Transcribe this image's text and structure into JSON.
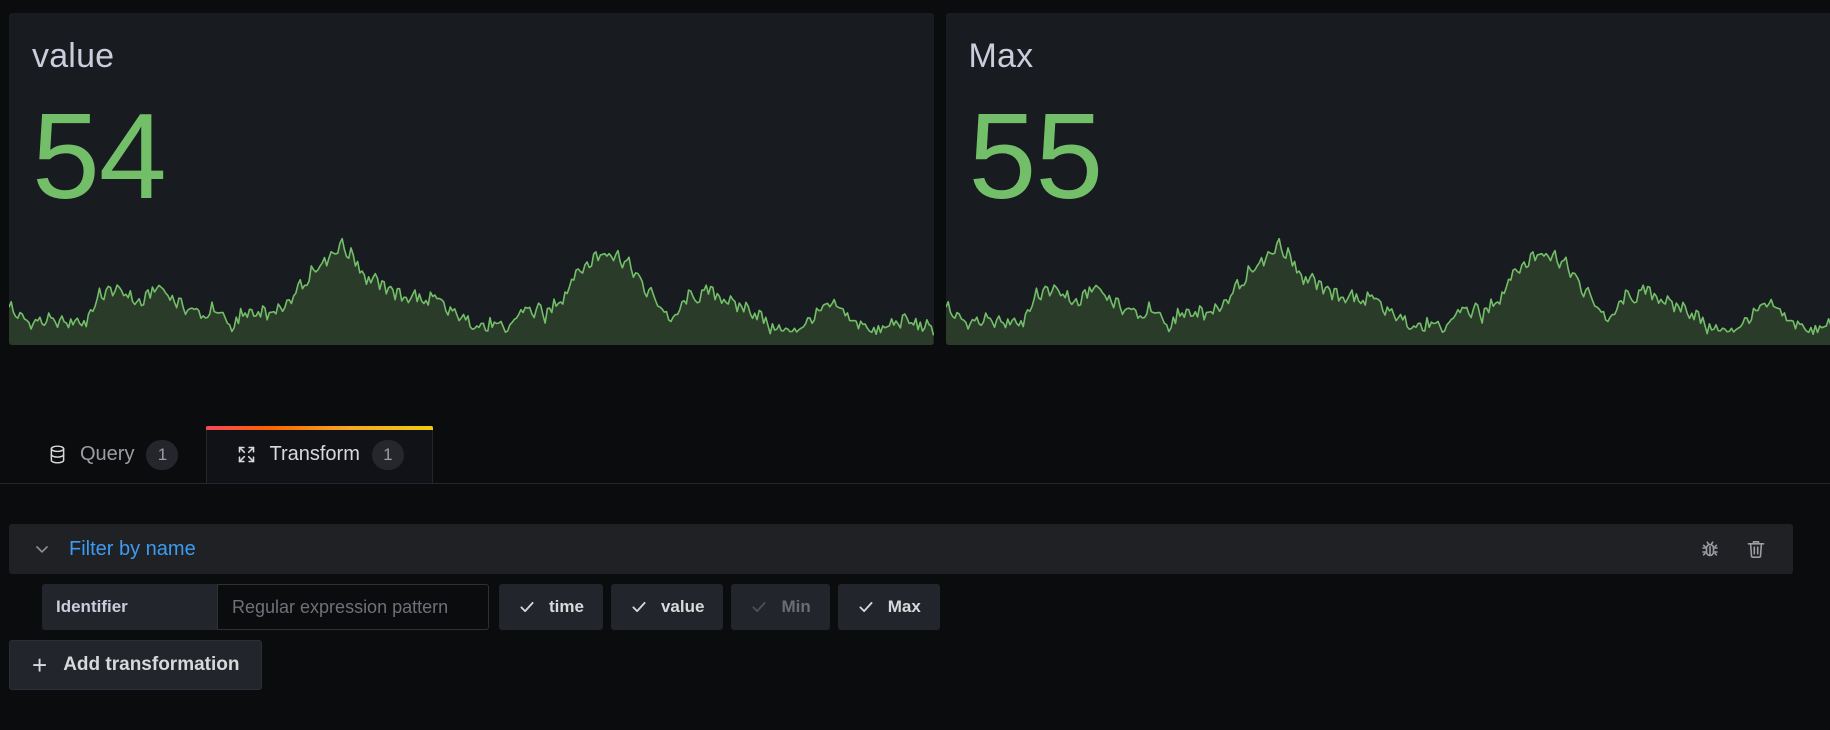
{
  "panels": [
    {
      "title": "value",
      "value": "54",
      "color": "#73bf69",
      "fill": "#2a3b2a"
    },
    {
      "title": "Max",
      "value": "55",
      "color": "#73bf69",
      "fill": "#2a3b2a"
    }
  ],
  "tabs": [
    {
      "label": "Query",
      "badge": "1",
      "icon": "database-icon",
      "active": false
    },
    {
      "label": "Transform",
      "badge": "1",
      "icon": "transform-icon",
      "active": true
    }
  ],
  "transformation": {
    "name": "Filter by name",
    "expanded": true,
    "identifier_label": "Identifier",
    "regex_value": "",
    "regex_placeholder": "Regular expression pattern",
    "fields": [
      {
        "label": "time",
        "checked": true
      },
      {
        "label": "value",
        "checked": true
      },
      {
        "label": "Min",
        "checked": false
      },
      {
        "label": "Max",
        "checked": true
      }
    ],
    "debug_title": "Debug",
    "remove_title": "Remove"
  },
  "add_transformation_label": "Add transformation",
  "chart_data": {
    "type": "area",
    "title": "",
    "xlabel": "",
    "ylabel": "",
    "grid": false,
    "legend": "none",
    "series": [
      {
        "name": "value",
        "color": "#73bf69",
        "fill": "#2a3b2a",
        "values": [
          44,
          41,
          39,
          40,
          38,
          36,
          37,
          35,
          36,
          38,
          36,
          35,
          37,
          36,
          34,
          36,
          35,
          37,
          35,
          34,
          36,
          38,
          36,
          35,
          37,
          39,
          41,
          44,
          47,
          45,
          48,
          50,
          48,
          49,
          47,
          48,
          46,
          48,
          46,
          44,
          45,
          43,
          44,
          46,
          48,
          50,
          48,
          51,
          49,
          47,
          48,
          46,
          44,
          45,
          43,
          41,
          42,
          40,
          41,
          39,
          40,
          38,
          39,
          41,
          39,
          38,
          40,
          38,
          36,
          34,
          35,
          37,
          39,
          38,
          40,
          39,
          37,
          39,
          38,
          40,
          39,
          38,
          40,
          42,
          41,
          40,
          42,
          44,
          46,
          49,
          52,
          50,
          53,
          55,
          58,
          56,
          59,
          62,
          60,
          63,
          65,
          63,
          66,
          68,
          66,
          64,
          65,
          63,
          60,
          58,
          56,
          54,
          52,
          54,
          52,
          50,
          51,
          49,
          51,
          49,
          47,
          48,
          46,
          47,
          45,
          46,
          48,
          46,
          44,
          43,
          45,
          47,
          45,
          43,
          44,
          42,
          40,
          41,
          39,
          38,
          40,
          38,
          36,
          37,
          35,
          36,
          34,
          35,
          33,
          34,
          36,
          35,
          33,
          34,
          32,
          33,
          35,
          37,
          39,
          41,
          40,
          42,
          41,
          39,
          41,
          40,
          38,
          39,
          41,
          43,
          45,
          44,
          46,
          48,
          51,
          54,
          57,
          55,
          58,
          61,
          59,
          62,
          64,
          62,
          65,
          63,
          66,
          64,
          62,
          63,
          61,
          59,
          60,
          58,
          56,
          54,
          52,
          50,
          48,
          49,
          47,
          45,
          43,
          41,
          39,
          37,
          36,
          38,
          40,
          42,
          44,
          46,
          45,
          47,
          46,
          48,
          47,
          49,
          48,
          46,
          47,
          45,
          46,
          44,
          45,
          43,
          42,
          44,
          43,
          41,
          42,
          40,
          38,
          39,
          37,
          36,
          34,
          33,
          35,
          34,
          32,
          33,
          31,
          32,
          34,
          33,
          35,
          34,
          36,
          38,
          37,
          39,
          41,
          40,
          42,
          41,
          43,
          42,
          40,
          41,
          39,
          38,
          36,
          35,
          34,
          36,
          35,
          33,
          34,
          32,
          31,
          33,
          32,
          34,
          36,
          35,
          37,
          36,
          38,
          37,
          35,
          36,
          34,
          33,
          35,
          34,
          32,
          31
        ]
      }
    ]
  }
}
